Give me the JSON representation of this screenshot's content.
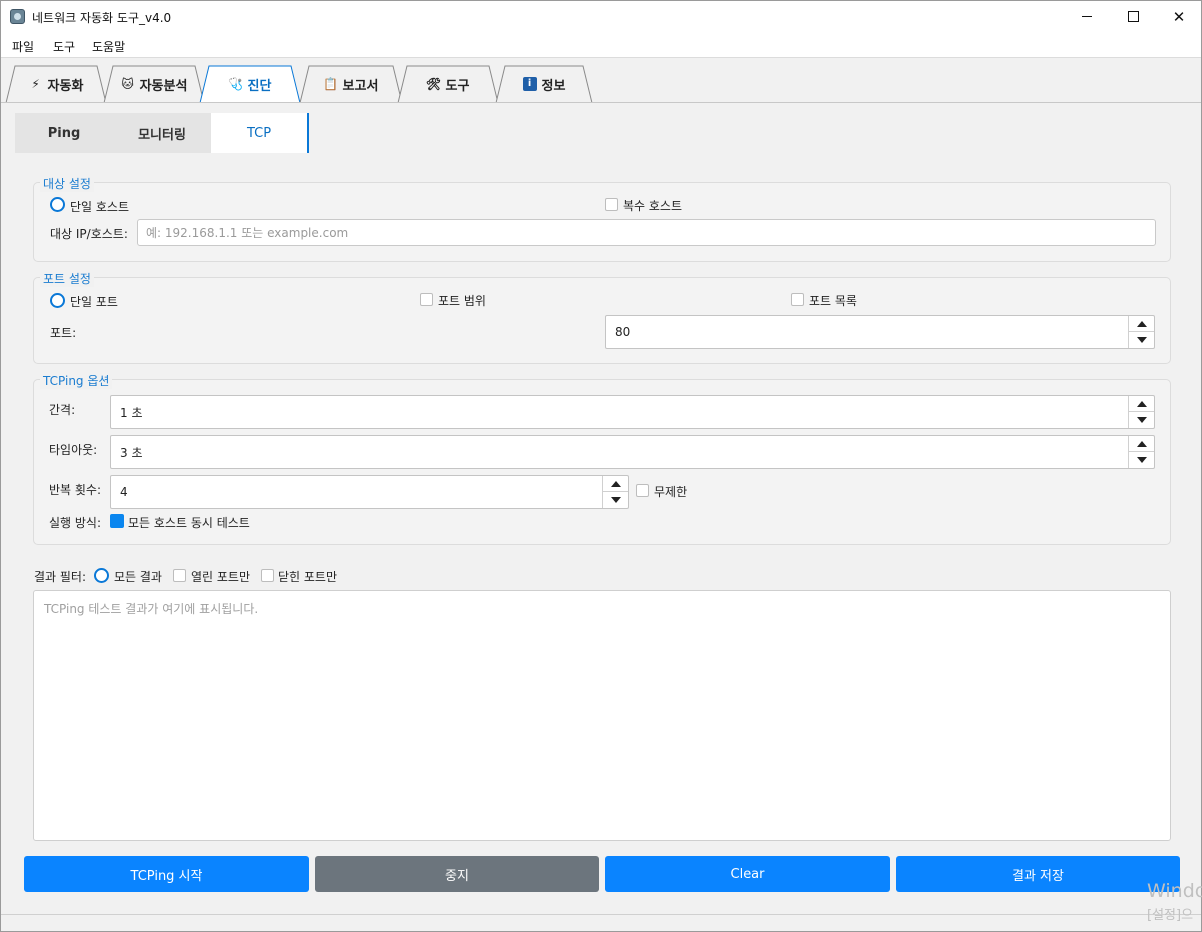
{
  "window": {
    "title": "네트워크 자동화 도구_v4.0"
  },
  "menu": [
    "파일",
    "도구",
    "도움말"
  ],
  "main_tabs": [
    {
      "label": "자동화",
      "icon": "lightning-icon",
      "glyph": "⚡"
    },
    {
      "label": "자동분석",
      "icon": "robot-icon",
      "glyph": "🐱"
    },
    {
      "label": "진단",
      "icon": "stethoscope-icon",
      "glyph": "🩺"
    },
    {
      "label": "보고서",
      "icon": "clipboard-icon",
      "glyph": "📋"
    },
    {
      "label": "도구",
      "icon": "tools-icon",
      "glyph": "🛠"
    },
    {
      "label": "정보",
      "icon": "info-icon",
      "glyph": "i"
    }
  ],
  "active_main_tab": "진단",
  "sub_tabs": [
    "Ping",
    "모니터링",
    "TCP"
  ],
  "active_sub_tab": "TCP",
  "target": {
    "title": "대상 설정",
    "single_host": "단일 호스트",
    "multi_host": "복수 호스트",
    "ip_label": "대상 IP/호스트:",
    "ip_placeholder": "예: 192.168.1.1 또는 example.com"
  },
  "port": {
    "title": "포트 설정",
    "single": "단일 포트",
    "range": "포트 범위",
    "list": "포트 목록",
    "port_label": "포트:",
    "port_value": "80"
  },
  "options": {
    "title": "TCPing 옵션",
    "interval_label": "간격:",
    "interval_value": "1 초",
    "timeout_label": "타임아웃:",
    "timeout_value": "3 초",
    "repeat_label": "반복 횟수:",
    "repeat_value": "4",
    "unlimited": "무제한",
    "exec_label": "실행 방식:",
    "exec_option": "모든 호스트 동시 테스트"
  },
  "filter": {
    "label": "결과 필터:",
    "all": "모든 결과",
    "open": "열린 포트만",
    "closed": "닫힌 포트만"
  },
  "result_placeholder": "TCPing 테스트 결과가 여기에 표시됩니다.",
  "buttons": {
    "start": "TCPing 시작",
    "stop": "중지",
    "clear": "Clear",
    "save": "결과 저장"
  },
  "watermark": {
    "line1": "Windo",
    "line2": "[설정]으"
  },
  "colors": {
    "accent": "#0a84ff",
    "stop_button": "#6c757d",
    "group_title": "#1a7cd0"
  }
}
